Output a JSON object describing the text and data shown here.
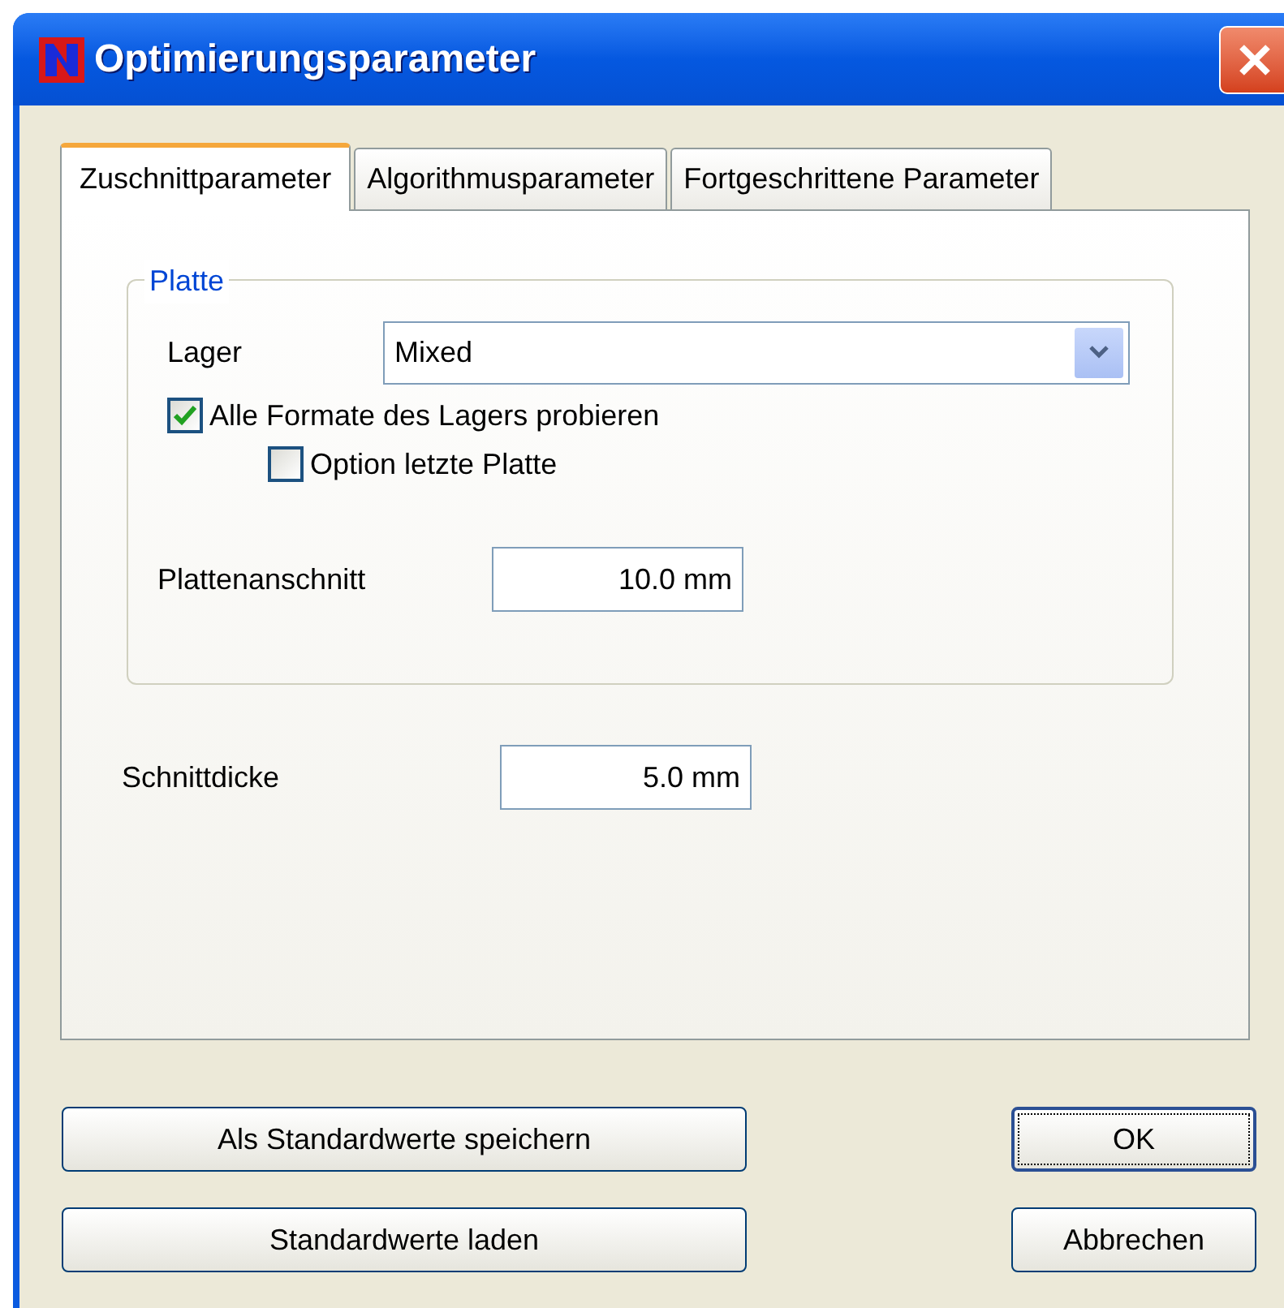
{
  "window": {
    "title": "Optimierungsparameter"
  },
  "tabs": [
    {
      "label": "Zuschnittparameter",
      "selected": true
    },
    {
      "label": "Algorithmusparameter",
      "selected": false
    },
    {
      "label": "Fortgeschrittene Parameter",
      "selected": false
    }
  ],
  "group": {
    "title": "Platte",
    "store": {
      "label": "Lager",
      "value": "Mixed"
    },
    "checkboxes": [
      {
        "label": "Alle Formate des Lagers probieren",
        "checked": true,
        "children": [
          {
            "label": "Option letzte Platte",
            "checked": false
          }
        ]
      }
    ],
    "trim": {
      "label": "Plattenanschnitt",
      "value": "10.0 mm"
    }
  },
  "kerf": {
    "label": "Schnittdicke",
    "value": "5.0 mm"
  },
  "buttons": [
    {
      "label": "Als Standardwerte speichern",
      "focused": false
    },
    {
      "label": "OK",
      "focused": true
    },
    {
      "label": "Standardwerte laden",
      "focused": false
    },
    {
      "label": "Abbrechen",
      "focused": false
    }
  ]
}
